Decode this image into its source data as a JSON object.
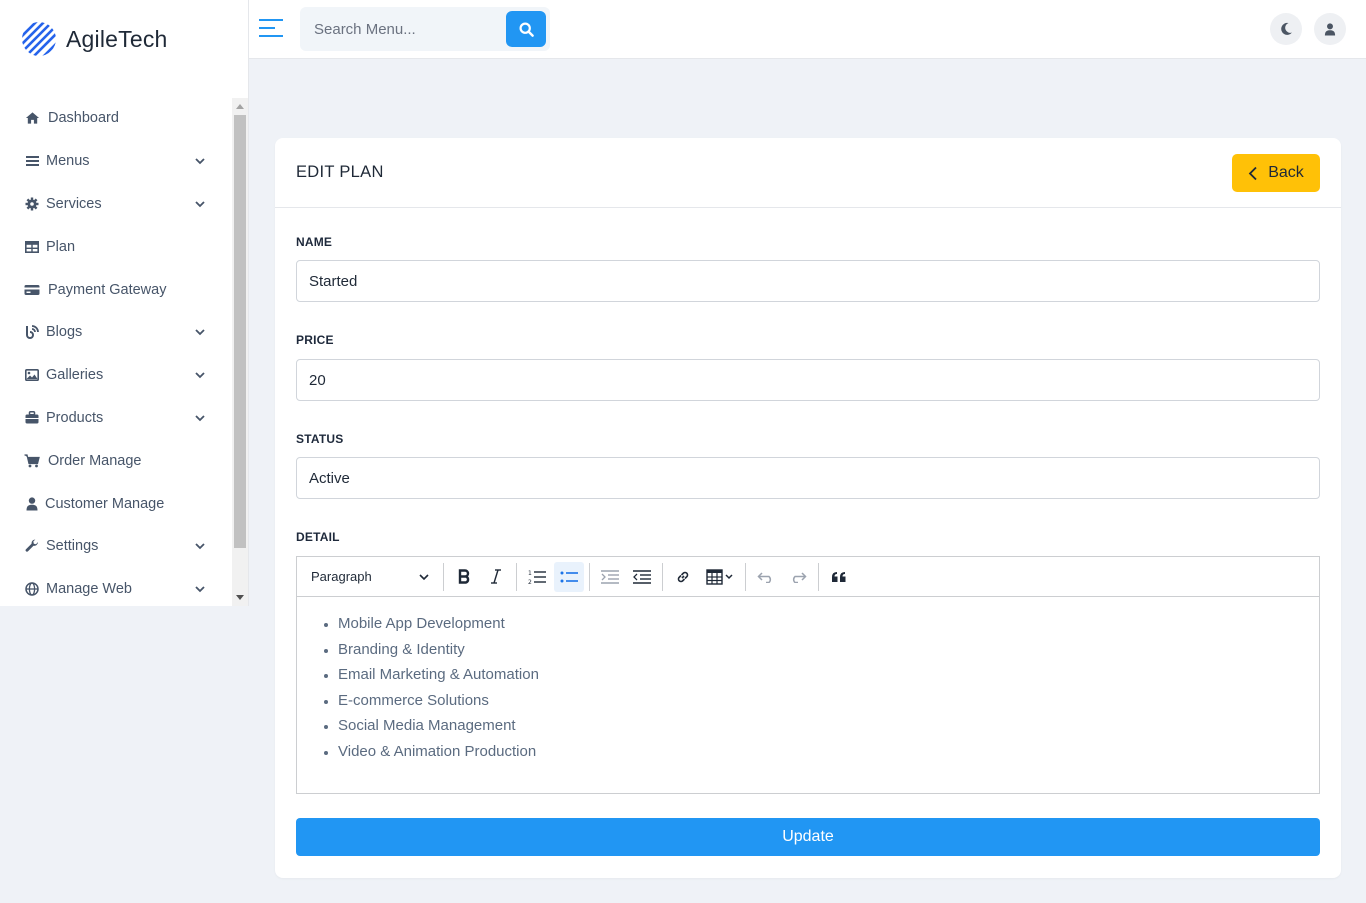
{
  "brand": {
    "name": "AgileTech",
    "accent": "#2196f3"
  },
  "sidebar": {
    "items": [
      {
        "label": "Dashboard",
        "icon": "home-icon",
        "has_submenu": false
      },
      {
        "label": "Menus",
        "icon": "bars-icon",
        "has_submenu": true
      },
      {
        "label": "Services",
        "icon": "gear-icon",
        "has_submenu": true
      },
      {
        "label": "Plan",
        "icon": "table-icon",
        "has_submenu": false
      },
      {
        "label": "Payment Gateway",
        "icon": "credit-card-icon",
        "has_submenu": false
      },
      {
        "label": "Blogs",
        "icon": "blog-icon",
        "has_submenu": true
      },
      {
        "label": "Galleries",
        "icon": "image-icon",
        "has_submenu": true
      },
      {
        "label": "Products",
        "icon": "briefcase-icon",
        "has_submenu": true
      },
      {
        "label": "Order Manage",
        "icon": "cart-icon",
        "has_submenu": false
      },
      {
        "label": "Customer Manage",
        "icon": "user-icon",
        "has_submenu": false
      },
      {
        "label": "Settings",
        "icon": "wrench-icon",
        "has_submenu": true
      },
      {
        "label": "Manage Web",
        "icon": "globe-icon",
        "has_submenu": true
      }
    ]
  },
  "topbar": {
    "search_placeholder": "Search Menu...",
    "search_value": ""
  },
  "card": {
    "title": "EDIT PLAN",
    "back_label": "Back",
    "fields": {
      "name_label": "NAME",
      "name_value": "Started",
      "price_label": "PRICE",
      "price_value": "20",
      "status_label": "STATUS",
      "status_value": "Active",
      "detail_label": "DETAIL"
    },
    "editor": {
      "heading_select": "Paragraph",
      "items": [
        "Mobile App Development",
        "Branding & Identity",
        "Email Marketing & Automation",
        "E-commerce Solutions",
        "Social Media Management",
        "Video & Animation Production"
      ]
    },
    "submit_label": "Update"
  },
  "colors": {
    "back_button": "#ffc107",
    "update_button": "#2196f3",
    "background": "#eff2f7"
  }
}
